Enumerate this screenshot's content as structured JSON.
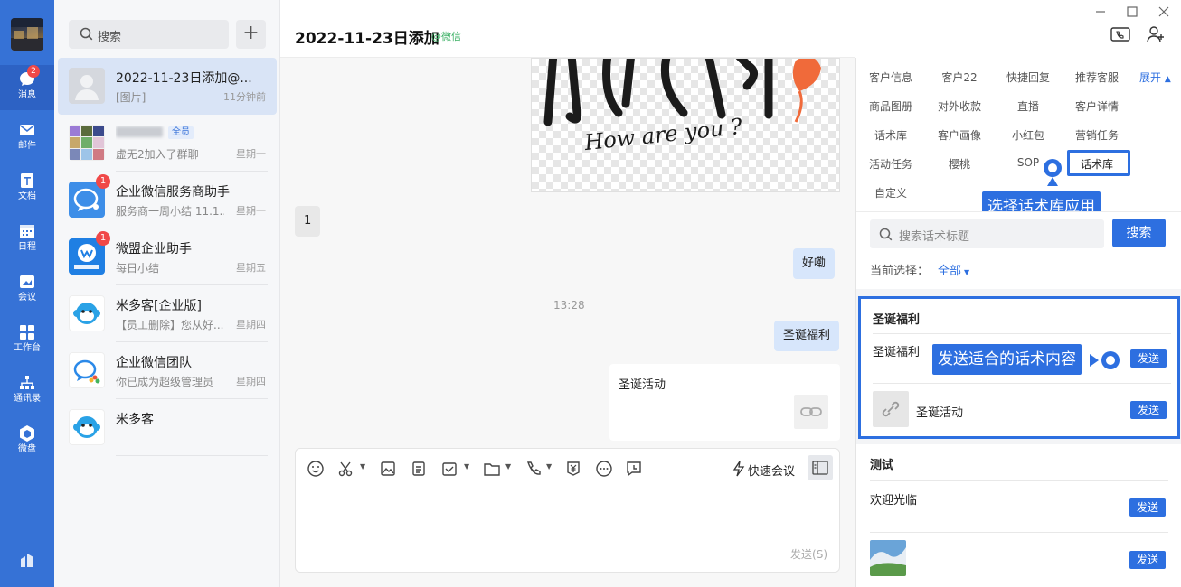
{
  "rail": {
    "items": [
      {
        "label": "消息",
        "icon": "chat-bubble-icon",
        "badge": "2"
      },
      {
        "label": "邮件",
        "icon": "mail-icon"
      },
      {
        "label": "文档",
        "icon": "document-icon"
      },
      {
        "label": "日程",
        "icon": "calendar-icon"
      },
      {
        "label": "会议",
        "icon": "meeting-icon"
      },
      {
        "label": "工作台",
        "icon": "workbench-grid-icon"
      },
      {
        "label": "通讯录",
        "icon": "contacts-icon"
      },
      {
        "label": "微盘",
        "icon": "weipan-icon"
      }
    ]
  },
  "conversations": {
    "search_placeholder": "搜索",
    "add_label": "+",
    "items": [
      {
        "name": "2022-11-23日添加@...",
        "preview": "[图片]",
        "time": "11分钟前"
      },
      {
        "name": "",
        "tag": "全员",
        "preview": "虚无2加入了群聊",
        "time": "星期一"
      },
      {
        "name": "企业微信服务商助手",
        "preview": "服务商一周小结 11.1...",
        "time": "星期一",
        "badge": "1"
      },
      {
        "name": "微盟企业助手",
        "preview": "每日小结",
        "time": "星期五",
        "badge": "1"
      },
      {
        "name": "米多客[企业版]",
        "preview": "【员工删除】您从好...",
        "time": "星期四"
      },
      {
        "name": "企业微信团队",
        "preview": "你已成为超级管理员",
        "time": "星期四"
      },
      {
        "name": "米多客",
        "preview": "",
        "time": ""
      }
    ]
  },
  "chat": {
    "title": "2022-11-23日添加",
    "source_tag": "@微信",
    "sticker_caption": "How are you ?",
    "messages": {
      "m1": "1",
      "m2": "好嘞",
      "timestamp": "13:28",
      "m3": "圣诞福利",
      "link_card_title": "圣诞活动"
    },
    "toolbar": {
      "quick_meeting": "快速会议",
      "send_label": "发送(S)"
    }
  },
  "right_panel": {
    "tabs_row1": [
      "客户信息",
      "客户22",
      "快捷回复",
      "推荐客服"
    ],
    "expand_label": "展开",
    "tabs_row2": [
      "商品图册",
      "对外收款",
      "直播",
      "客户详情"
    ],
    "tabs_row3": [
      "话术库",
      "客户画像",
      "小红包",
      "营销任务"
    ],
    "tabs_row4": [
      "活动任务",
      "樱桃",
      "SOP",
      "话术库"
    ],
    "tabs_row5": [
      "自定义"
    ],
    "callout_select": "选择话术库应用",
    "search_placeholder": "搜索话术标题",
    "search_button": "搜索",
    "current_select_label": "当前选择：",
    "current_select_value": "全部",
    "groups": [
      {
        "title": "圣诞福利",
        "items": [
          {
            "text": "圣诞福利",
            "send": "发送"
          },
          {
            "text": "圣诞活动",
            "send": "发送"
          }
        ]
      },
      {
        "title": "测试",
        "items": [
          {
            "text": "欢迎光临",
            "send": "发送"
          },
          {
            "text": "",
            "send": "发送"
          }
        ]
      }
    ],
    "callout_send": "发送适合的话术内容"
  },
  "colors": {
    "accent": "#2d6fe0",
    "rail": "#3672d6",
    "badge": "#f04848",
    "wechat_green": "#3bb064"
  }
}
